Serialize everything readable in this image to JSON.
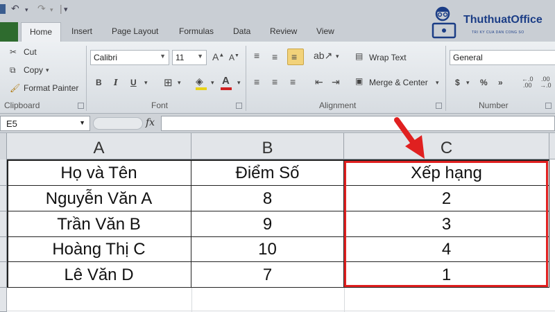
{
  "tabs": [
    "Home",
    "Insert",
    "Page Layout",
    "Formulas",
    "Data",
    "Review",
    "View"
  ],
  "logo": {
    "name": "ThuthuatOffice",
    "tagline": "TRI KY CUA DAN CONG SO"
  },
  "clipboard": {
    "cut_label": "Cut",
    "copy_label": "Copy",
    "format_painter_label": "Format Painter",
    "group_label": "Clipboard"
  },
  "font": {
    "name": "Calibri",
    "size": "11",
    "group_label": "Font",
    "bold": "B",
    "italic": "I",
    "underline": "U"
  },
  "alignment": {
    "wrap_text_label": "Wrap Text",
    "merge_center_label": "Merge & Center",
    "group_label": "Alignment"
  },
  "number": {
    "format": "General",
    "currency": "$",
    "percent": "%",
    "comma": "»",
    "group_label": "Number"
  },
  "formula_bar": {
    "name_box": "E5",
    "fx": "fx",
    "value": ""
  },
  "sheet": {
    "columns": [
      "A",
      "B",
      "C"
    ],
    "rows": [
      [
        "Họ và Tên",
        "Điểm Số",
        "Xếp hạng"
      ],
      [
        "Nguyễn Văn A",
        "8",
        "2"
      ],
      [
        "Trần Văn B",
        "9",
        "3"
      ],
      [
        "Hoàng Thị C",
        "10",
        "4"
      ],
      [
        "Lê Văn D",
        "7",
        "1"
      ]
    ]
  },
  "colors": {
    "highlight": "#e02020",
    "accent_green": "#2e6b2e",
    "logo_blue": "#1b3d86"
  },
  "icons": [
    "save-icon",
    "undo-icon",
    "redo-icon",
    "scissors-icon",
    "copy-icon",
    "paintbrush-icon",
    "borders-icon",
    "fill-color-icon",
    "font-color-icon",
    "align-icon",
    "red-arrow-icon"
  ]
}
